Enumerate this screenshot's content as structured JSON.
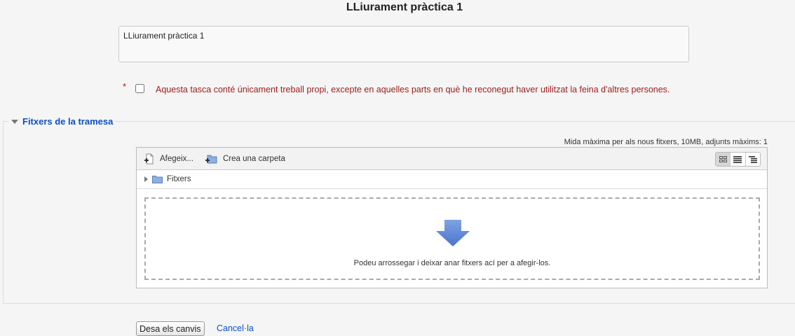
{
  "page": {
    "title": "LLiurament pràctica 1",
    "submission_text": "LLiurament pràctica 1"
  },
  "statement": {
    "required_marker": "*",
    "text": "Aquesta tasca conté únicament treball propi, excepte en aquelles parts en què he reconegut haver utilitzat la feina d'altres persones.",
    "checked": false
  },
  "files_section": {
    "legend": "Fitxers de la tramesa",
    "max_size_note": "Mida màxima per als nous fitxers, 10MB, adjunts màxims: 1",
    "toolbar": {
      "add_label": "Afegeix...",
      "create_folder_label": "Crea una carpeta",
      "views": [
        "icons-view",
        "list-view",
        "tree-view"
      ],
      "active_view": "icons-view"
    },
    "path": {
      "folder_label": "Fitxers"
    },
    "dropzone_text": "Podeu arrossegar i deixar anar fitxers ací per a afegir-los."
  },
  "actions": {
    "save_label": "Desa els canvis",
    "cancel_label": "Cancel·la"
  },
  "colors": {
    "link": "#0b4fc9",
    "statement_text": "#9e1a1a",
    "required": "#cc0000",
    "arrow": "#5b85d6"
  }
}
